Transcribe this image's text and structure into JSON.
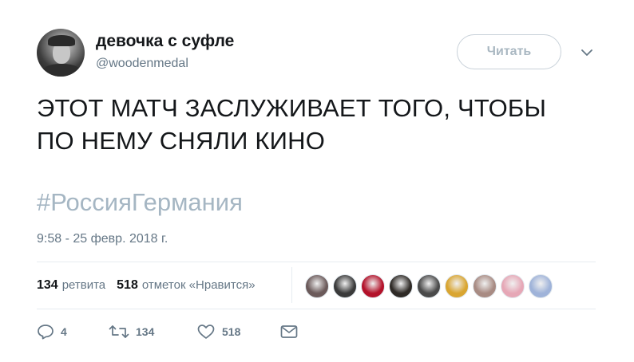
{
  "user": {
    "display_name": "девочка с суфле",
    "handle": "@woodenmedal"
  },
  "follow_button": {
    "label": "Читать"
  },
  "tweet": {
    "text": "ЭТОТ МАТЧ ЗАСЛУЖИВАЕТ ТОГО,  ЧТОБЫ\nПО НЕМУ СНЯЛИ КИНО",
    "hashtag": "#РоссияГермания",
    "timestamp": "9:58 - 25 февр. 2018 г."
  },
  "stats": {
    "retweets_count": "134",
    "retweets_label": "ретвита",
    "likes_count": "518",
    "likes_label": "отметок «Нравится»"
  },
  "likers": [
    {
      "color": "#6b5a5a"
    },
    {
      "color": "#3a3a3a"
    },
    {
      "color": "#b3122a"
    },
    {
      "color": "#2e2a26"
    },
    {
      "color": "#4a4a4a"
    },
    {
      "color": "#d9a531"
    },
    {
      "color": "#a88b83"
    },
    {
      "color": "#e6a7b6"
    },
    {
      "color": "#9fb3d9"
    }
  ],
  "actions": {
    "reply_count": "4",
    "retweet_count": "134",
    "like_count": "518"
  },
  "icons": {
    "reply": "reply-icon",
    "retweet": "retweet-icon",
    "like": "heart-icon",
    "message": "envelope-icon",
    "caret": "chevron-down-icon"
  },
  "colors": {
    "text": "#14171a",
    "secondary": "#657786",
    "hashtag": "#a5b6c3",
    "border": "#e6ecf0"
  }
}
